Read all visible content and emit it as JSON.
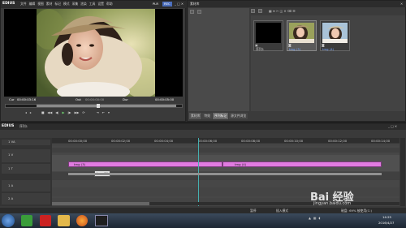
{
  "player": {
    "app_name": "EDIUS",
    "menu": [
      "文件",
      "编辑",
      "视图",
      "素材",
      "标记",
      "模式",
      "采集",
      "渲染",
      "工具",
      "设置",
      "帮助"
    ],
    "mode_label": "PLR",
    "mode_rec": "REC",
    "tc_cur": "00:00:03:16",
    "tc_in_label": "Cur",
    "tc_out_label": "Out",
    "tc_dur_label": "Dur",
    "tc_in": "00:00:00:00",
    "tc_out": "--:--:--:--",
    "tc_dur": "00:00:05:00"
  },
  "bin": {
    "title": "素材库",
    "tabs": [
      "素材库",
      "特效",
      "序列标记",
      "源文件浏览"
    ],
    "clips": [
      {
        "label": "序列1",
        "selected": false
      },
      {
        "label": "tmg (3)",
        "selected": true
      },
      {
        "label": "tmg (4)",
        "selected": false
      }
    ]
  },
  "timeline": {
    "app_name": "EDIUS",
    "sequence": "序列1",
    "ruler": [
      "00:00:00;00",
      "00:00:02;00",
      "00:00:04;00",
      "00:00:06;00",
      "00:00:08;00",
      "00:00:10;00",
      "00:00:12;00",
      "00:00:14;00"
    ],
    "tracks": [
      "1 VA",
      "1 V",
      "1 T",
      "1 A",
      "2 A"
    ],
    "clips": [
      "tmg (3)",
      "tmg (4)"
    ],
    "tooltip": "tmg (3)",
    "status_left": "暂停",
    "status_mid": "插入模式",
    "status_right": "磁盘: 69% 被使用(C:)"
  },
  "taskbar": {
    "time": "14:25",
    "date": "2016/4/27"
  },
  "watermark": {
    "text": "Bai 经验",
    "url": "jingyan.baidu.com"
  },
  "colors": {
    "clip_pink": "#e07be0",
    "accent_blue": "#4a6dbb",
    "timeline_cursor": "#45b0b0"
  }
}
